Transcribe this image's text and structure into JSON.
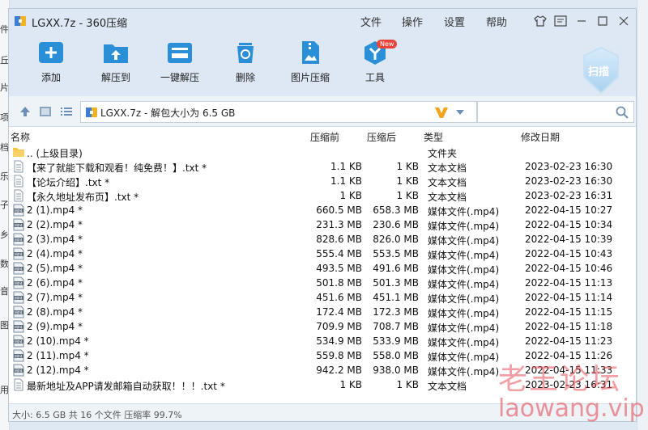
{
  "window": {
    "title": "LGXX.7z - 360压缩"
  },
  "menu": [
    "文件",
    "操作",
    "设置",
    "帮助"
  ],
  "toolbar": {
    "add": "添加",
    "extract_to": "解压到",
    "one_click_extract": "一键解压",
    "delete": "删除",
    "image_compress": "图片压缩",
    "tools": "工具",
    "tools_badge": "New",
    "scan": "扫描"
  },
  "address": {
    "path": "LGXX.7z - 解包大小为 6.5 GB"
  },
  "columns": {
    "name": "名称",
    "compressed_before": "压缩前",
    "compressed_after": "压缩后",
    "type": "类型",
    "modified": "修改日期"
  },
  "files": [
    {
      "icon": "folder-icon",
      "name": ".. (上级目录)",
      "size": "",
      "packed": "",
      "type": "文件夹",
      "date": ""
    },
    {
      "icon": "text-file-icon",
      "name": "【来了就能下载和观看！纯免费！】.txt *",
      "size": "1.1 KB",
      "packed": "1 KB",
      "type": "文本文档",
      "date": "2023-02-23 16:30"
    },
    {
      "icon": "text-file-icon",
      "name": "【论坛介绍】.txt *",
      "size": "1.1 KB",
      "packed": "1 KB",
      "type": "文本文档",
      "date": "2023-02-23 16:30"
    },
    {
      "icon": "text-file-icon",
      "name": "【永久地址发布页】.txt *",
      "size": "1 KB",
      "packed": "1 KB",
      "type": "文本文档",
      "date": "2023-02-23 16:31"
    },
    {
      "icon": "mp4-file-icon",
      "name": "2 (1).mp4 *",
      "size": "660.5 MB",
      "packed": "658.3 MB",
      "type": "媒体文件(.mp4)",
      "date": "2022-04-15 10:27"
    },
    {
      "icon": "mp4-file-icon",
      "name": "2 (2).mp4 *",
      "size": "231.3 MB",
      "packed": "230.6 MB",
      "type": "媒体文件(.mp4)",
      "date": "2022-04-15 10:34"
    },
    {
      "icon": "mp4-file-icon",
      "name": "2 (3).mp4 *",
      "size": "828.6 MB",
      "packed": "826.0 MB",
      "type": "媒体文件(.mp4)",
      "date": "2022-04-15 10:39"
    },
    {
      "icon": "mp4-file-icon",
      "name": "2 (4).mp4 *",
      "size": "555.4 MB",
      "packed": "553.5 MB",
      "type": "媒体文件(.mp4)",
      "date": "2022-04-15 10:43"
    },
    {
      "icon": "mp4-file-icon",
      "name": "2 (5).mp4 *",
      "size": "493.5 MB",
      "packed": "491.6 MB",
      "type": "媒体文件(.mp4)",
      "date": "2022-04-15 10:46"
    },
    {
      "icon": "mp4-file-icon",
      "name": "2 (6).mp4 *",
      "size": "501.8 MB",
      "packed": "501.3 MB",
      "type": "媒体文件(.mp4)",
      "date": "2022-04-15 11:13"
    },
    {
      "icon": "mp4-file-icon",
      "name": "2 (7).mp4 *",
      "size": "451.6 MB",
      "packed": "451.1 MB",
      "type": "媒体文件(.mp4)",
      "date": "2022-04-15 11:14"
    },
    {
      "icon": "mp4-file-icon",
      "name": "2 (8).mp4 *",
      "size": "172.4 MB",
      "packed": "172.3 MB",
      "type": "媒体文件(.mp4)",
      "date": "2022-04-15 11:15"
    },
    {
      "icon": "mp4-file-icon",
      "name": "2 (9).mp4 *",
      "size": "709.9 MB",
      "packed": "708.7 MB",
      "type": "媒体文件(.mp4)",
      "date": "2022-04-15 11:18"
    },
    {
      "icon": "mp4-file-icon",
      "name": "2 (10).mp4 *",
      "size": "534.9 MB",
      "packed": "533.9 MB",
      "type": "媒体文件(.mp4)",
      "date": "2022-04-15 11:23"
    },
    {
      "icon": "mp4-file-icon",
      "name": "2 (11).mp4 *",
      "size": "559.8 MB",
      "packed": "558.0 MB",
      "type": "媒体文件(.mp4)",
      "date": "2022-04-15 11:26"
    },
    {
      "icon": "mp4-file-icon",
      "name": "2 (12).mp4 *",
      "size": "942.2 MB",
      "packed": "938.0 MB",
      "type": "媒体文件(.mp4)",
      "date": "2022-04-15 11:33"
    },
    {
      "icon": "text-file-icon",
      "name": "最新地址及APP请发邮箱自动获取！！！.txt *",
      "size": "1 KB",
      "packed": "1 KB",
      "type": "文本文档",
      "date": "2023-02-23 16:31"
    }
  ],
  "status": {
    "text": "大小: 6.5 GB 共 16 个文件 压缩率 99.7%"
  },
  "watermark": {
    "cn": "老王论坛",
    "en": "laowang.vip"
  },
  "background_left_chars": [
    "件",
    "丘",
    "片",
    "项",
    "档",
    "乐",
    "子",
    "乡",
    "数",
    "音",
    "图",
    "用"
  ],
  "colors": {
    "accent": "#2a8fd6",
    "titlebar": "#dde8f4",
    "badge": "#e8443a"
  }
}
